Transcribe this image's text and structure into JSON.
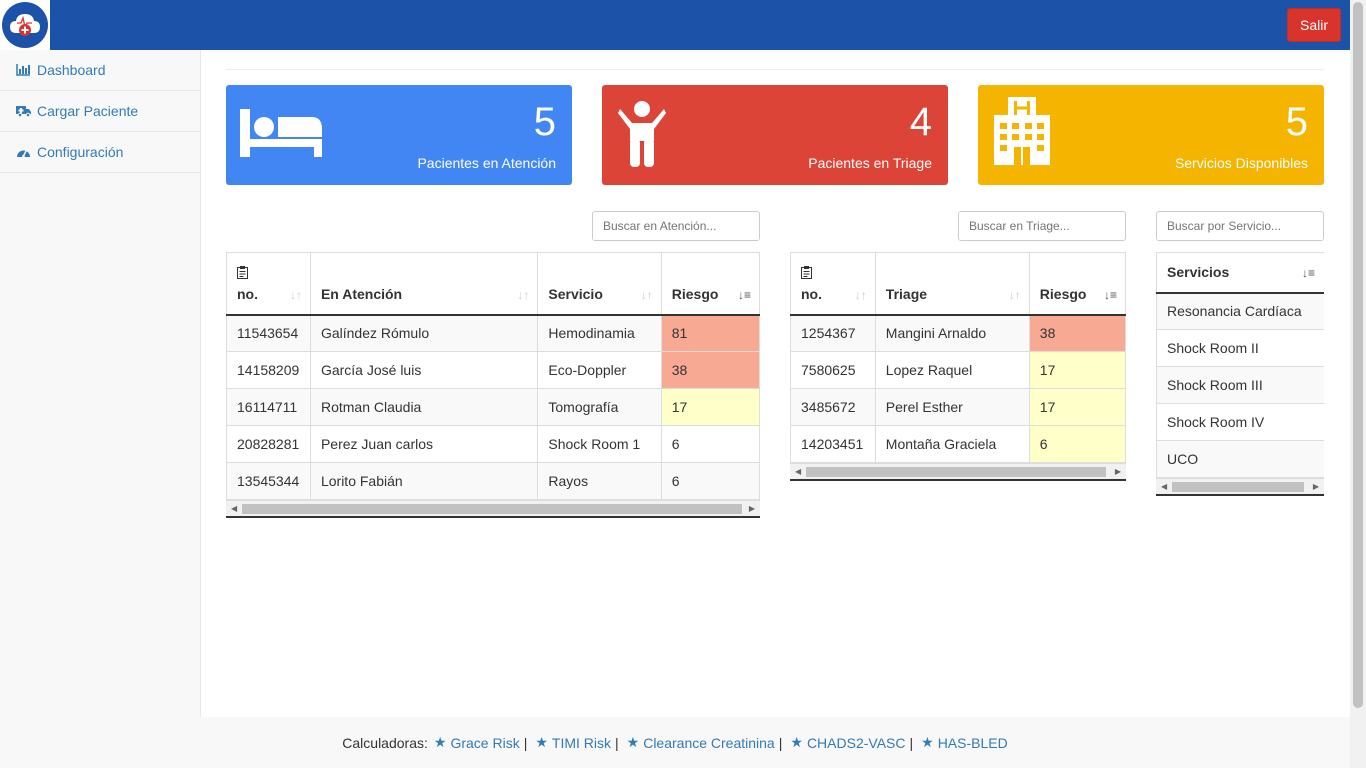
{
  "header": {
    "logout_label": "Salir"
  },
  "sidebar": {
    "items": [
      {
        "label": "Dashboard",
        "icon": "bar-chart-icon"
      },
      {
        "label": "Cargar Paciente",
        "icon": "ambulance-icon"
      },
      {
        "label": "Configuración",
        "icon": "dashboard-gauge-icon"
      }
    ]
  },
  "cards": [
    {
      "value": "5",
      "label": "Pacientes en Atención",
      "color": "#4286f4",
      "icon": "bed-icon"
    },
    {
      "value": "4",
      "label": "Pacientes en Triage",
      "color": "#db4437",
      "icon": "child-icon"
    },
    {
      "value": "5",
      "label": "Servicios Disponibles",
      "color": "#f4b400",
      "icon": "hospital-icon"
    }
  ],
  "search": {
    "atencion_placeholder": "Buscar en Atención...",
    "triage_placeholder": "Buscar en Triage...",
    "servicio_placeholder": "Buscar por Servicio..."
  },
  "atencion": {
    "headers": [
      "no.",
      "En Atención",
      "Servicio",
      "Riesgo"
    ],
    "rows": [
      [
        "11543654",
        "Galíndez Rómulo",
        "Hemodinamia",
        "81"
      ],
      [
        "14158209",
        "García José luis",
        "Eco-Doppler",
        "38"
      ],
      [
        "16114711",
        "Rotman Claudia",
        "Tomografía",
        "17"
      ],
      [
        "20828281",
        "Perez Juan carlos",
        "Shock Room 1",
        "6"
      ],
      [
        "13545344",
        "Lorito Fabián",
        "Rayos",
        "6"
      ]
    ]
  },
  "triage": {
    "headers": [
      "no.",
      "Triage",
      "Riesgo"
    ],
    "rows": [
      [
        "1254367",
        "Mangini Arnaldo",
        "38"
      ],
      [
        "7580625",
        "Lopez Raquel",
        "17"
      ],
      [
        "3485672",
        "Perel Esther",
        "17"
      ],
      [
        "14203451",
        "Montaña Graciela",
        "6"
      ]
    ]
  },
  "servicios": {
    "header": "Servicios",
    "rows": [
      "Resonancia Cardíaca",
      "Shock Room II",
      "Shock Room III",
      "Shock Room IV",
      "UCO"
    ]
  },
  "footer": {
    "prefix": "Calculadoras:",
    "links": [
      "Grace Risk",
      "TIMI Risk",
      "Clearance Creatinina",
      "CHADS2-VASC",
      "HAS-BLED"
    ]
  },
  "colors": {
    "risk_high": "#f8a994",
    "risk_mid": "#ffffca",
    "brand": "#1c53a8"
  }
}
